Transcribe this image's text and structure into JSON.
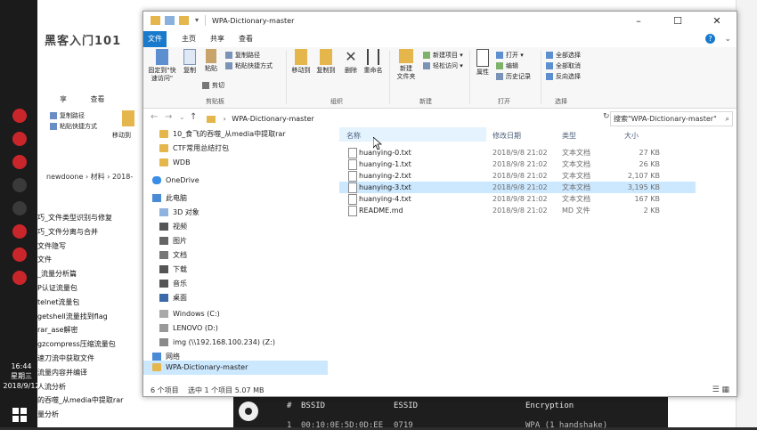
{
  "taskbar": {
    "time": "16:44",
    "weekday": "星期三",
    "date": "2018/9/12"
  },
  "bg_window": {
    "title_overlay": "黑客入门101",
    "ribbon_tabs": [
      "享",
      "查看"
    ],
    "ribbon_items": [
      "复制路径",
      "粘贴快捷方式",
      "移动到"
    ],
    "breadcrumb": "newdoone  ›  材料  ›  2018-",
    "list": [
      "巧_文件类型识别与修复",
      "巧_文件分离与合并",
      "文件隐写",
      "文件",
      "_流量分析篇",
      "P认证流量包",
      "telnet流量包",
      "getshell流量找到flag",
      "rar_ase解密",
      "gzcompress压缩流量包",
      "速刀流中获取文件",
      "流量内容并编译",
      "人流分析",
      "的吞噬_从media中提取rar",
      "量分析"
    ]
  },
  "explorer": {
    "title": "WPA-Dictionary-master",
    "tabs": {
      "file": "文件",
      "home": "主页",
      "share": "共享",
      "view": "查看"
    },
    "help_icon": "?",
    "ribbon": {
      "pin_label": "固定到\"快速访问\"",
      "copy_label": "复制",
      "paste_label": "粘贴",
      "copy_path": "复制路径",
      "paste_shortcut": "粘贴快捷方式",
      "cut": "剪切",
      "clipboard_group": "剪贴板",
      "move_to": "移动到",
      "copy_to": "复制到",
      "delete": "删除",
      "rename": "重命名",
      "organize_group": "组织",
      "new_folder": "新建\n文件夹",
      "new_item": "新建项目",
      "easy_access": "轻松访问",
      "new_group": "新建",
      "properties": "属性",
      "open": "打开",
      "edit": "编辑",
      "history": "历史记录",
      "open_group": "打开",
      "select_all": "全部选择",
      "select_none": "全部取消",
      "invert": "反向选择",
      "select_group": "选择"
    },
    "address": "WPA-Dictionary-master",
    "search_placeholder": "搜索\"WPA-Dictionary-master\"",
    "nav": {
      "items": [
        {
          "label": "10_食飞的吞噬_从media中提取rar",
          "icon": "folder-icon"
        },
        {
          "label": "CTF常用总结打包",
          "icon": "folder-icon"
        },
        {
          "label": "WDB",
          "icon": "folder-icon"
        },
        {
          "label": "OneDrive",
          "icon": "cloud-icon"
        },
        {
          "label": "此电脑",
          "icon": "computer-icon"
        },
        {
          "label": "3D 对象",
          "icon": "cube-icon"
        },
        {
          "label": "视频",
          "icon": "video-icon"
        },
        {
          "label": "图片",
          "icon": "image-icon"
        },
        {
          "label": "文档",
          "icon": "document-icon"
        },
        {
          "label": "下载",
          "icon": "download-icon"
        },
        {
          "label": "音乐",
          "icon": "music-icon"
        },
        {
          "label": "桌面",
          "icon": "desktop-icon"
        },
        {
          "label": "Windows (C:)",
          "icon": "drive-icon"
        },
        {
          "label": "LENOVO (D:)",
          "icon": "drive-icon"
        },
        {
          "label": "img (\\\\192.168.100.234) (Z:)",
          "icon": "network-drive-icon"
        },
        {
          "label": "网络",
          "icon": "network-icon"
        },
        {
          "label": "WPA-Dictionary-master",
          "icon": "folder-icon"
        }
      ]
    },
    "columns": {
      "name": "名称",
      "date": "修改日期",
      "type": "类型",
      "size": "大小"
    },
    "files": [
      {
        "name": "huanying-0.txt",
        "date": "2018/9/8 21:02",
        "type": "文本文档",
        "size": "27 KB"
      },
      {
        "name": "huanying-1.txt",
        "date": "2018/9/8 21:02",
        "type": "文本文档",
        "size": "26 KB"
      },
      {
        "name": "huanying-2.txt",
        "date": "2018/9/8 21:02",
        "type": "文本文档",
        "size": "2,107 KB"
      },
      {
        "name": "huanying-3.txt",
        "date": "2018/9/8 21:02",
        "type": "文本文档",
        "size": "3,195 KB"
      },
      {
        "name": "huanying-4.txt",
        "date": "2018/9/8 21:02",
        "type": "文本文档",
        "size": "167 KB"
      },
      {
        "name": "README.md",
        "date": "2018/9/8 21:02",
        "type": "MD 文件",
        "size": "2 KB"
      }
    ],
    "status": {
      "count": "6 个项目",
      "selected": "选中 1 个项目  5.07 MB"
    }
  },
  "terminal": {
    "headers": [
      "#",
      "BSSID",
      "ESSID",
      "Encryption"
    ],
    "row": [
      "1",
      "00:10:0E:5D:0D:EE",
      "0719",
      "WPA (1 handshake)"
    ]
  },
  "colors": {
    "accent": "#1979ca",
    "selection": "#cce8ff",
    "folder": "#e5b64c"
  }
}
